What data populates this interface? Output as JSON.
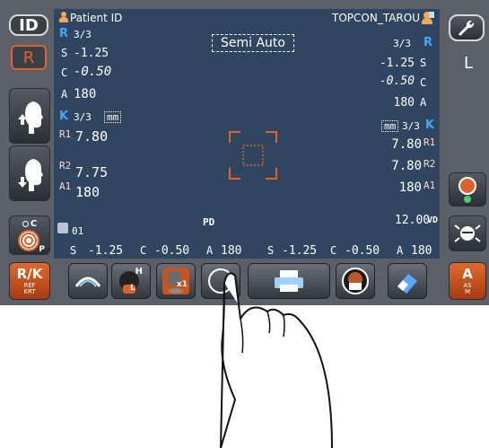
{
  "left_panel": {
    "id_button": "ID",
    "eye_indicator": "R",
    "mode_c_label": "C",
    "mode_p_label": "P",
    "rk_button": {
      "main": "R/K",
      "sub1": "REF",
      "sub2": "KRT"
    }
  },
  "right_panel": {
    "eye_indicator": "L",
    "a_button": {
      "main": "A",
      "sub1": "AS",
      "sub2": "M"
    }
  },
  "header": {
    "patient_label": "Patient ID",
    "mode": "Semi Auto",
    "operator": "TOPCON_TAROU"
  },
  "right_eye": {
    "eye": "R",
    "ref_count": "3/3",
    "s_label": "S",
    "s_value": "-1.25",
    "c_label": "C",
    "c_value": "-0.50",
    "a_label": "A",
    "a_value": "180",
    "k_eye": "K",
    "k_count": "3/3",
    "unit": "mm",
    "r1_label": "R1",
    "r1_value": "7.80",
    "r2_label": "R2",
    "r2_value": "7.75",
    "a1_label": "A1",
    "a1_value": "180"
  },
  "left_eye": {
    "eye": "R",
    "ref_count": "3/3",
    "s_label": "S",
    "s_value": "-1.25",
    "c_label": "C",
    "c_value": "-0.50",
    "a_label": "A",
    "a_value": "180",
    "k_eye": "K",
    "k_count": "3/3",
    "unit": "mm",
    "r1_label": "R1",
    "r1_value": "7.80",
    "r2_label": "R2",
    "r2_value": "7.80",
    "a1_label": "A1",
    "a1_value": "180"
  },
  "center": {
    "pd_label": "PD",
    "vd_value": "12.00",
    "vd_label": "VD"
  },
  "summary": {
    "page_number": "01",
    "s_label": "S",
    "s_value": "-1.25",
    "c_label": "C",
    "c_value": "-0.50",
    "a_label": "A",
    "a_value": "180",
    "s2_label": "S",
    "s2_value": "-1.25",
    "c2_label": "C",
    "c2_value": "-0.50",
    "a2_label": "A",
    "a2_value": "180"
  },
  "toolbar": {
    "h_label": "H",
    "l_label": "L",
    "x1_label": "x1"
  },
  "colors": {
    "screen": "#2f4560",
    "accent_blue": "#3fa7ff",
    "accent_orange": "#e0612a"
  }
}
